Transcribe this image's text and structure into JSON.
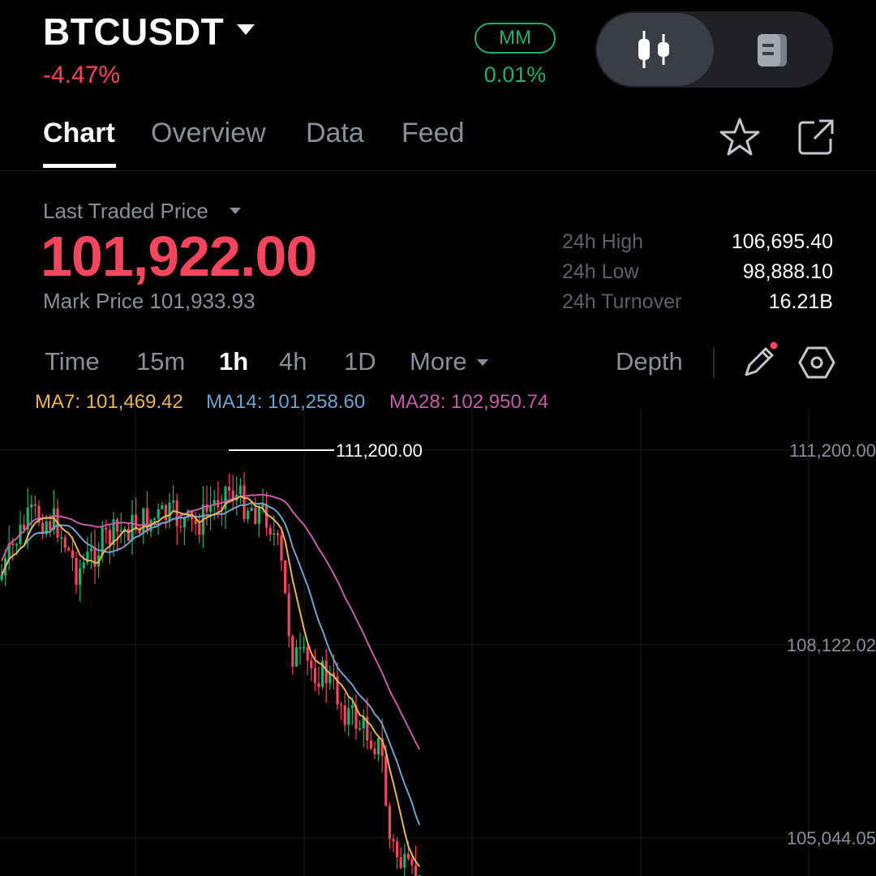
{
  "header": {
    "symbol": "BTCUSDT",
    "change_pct": "-4.47%",
    "mm_badge": "MM",
    "mm_value": "0.01%",
    "toggle_left_icon": "candlestick-icon",
    "toggle_right_icon": "document-icon"
  },
  "tabs": [
    {
      "label": "Chart",
      "active": true
    },
    {
      "label": "Overview",
      "active": false
    },
    {
      "label": "Data",
      "active": false
    },
    {
      "label": "Feed",
      "active": false
    }
  ],
  "tab_icons": [
    "star-icon",
    "share-icon"
  ],
  "price": {
    "last_traded_label": "Last Traded Price",
    "last_price": "101,922.00",
    "mark_price": "Mark Price 101,933.93"
  },
  "stats": [
    {
      "label": "24h High",
      "value": "106,695.40"
    },
    {
      "label": "24h Low",
      "value": "98,888.10"
    },
    {
      "label": "24h Turnover",
      "value": "16.21B"
    }
  ],
  "timeframes": [
    {
      "label": "Time",
      "active": false
    },
    {
      "label": "15m",
      "active": false
    },
    {
      "label": "1h",
      "active": true
    },
    {
      "label": "4h",
      "active": false
    },
    {
      "label": "1D",
      "active": false
    },
    {
      "label": "More",
      "active": false
    }
  ],
  "depth_label": "Depth",
  "tool_icons": [
    "pencil-icon",
    "hexagon-settings-icon"
  ],
  "moving_averages": [
    {
      "label": "MA7:",
      "value": "101,469.42",
      "color": "#e8b558"
    },
    {
      "label": "MA14:",
      "value": "101,258.60",
      "color": "#6fa3c9"
    },
    {
      "label": "MA28:",
      "value": "102,950.74",
      "color": "#c25fa8"
    }
  ],
  "chart_data": {
    "type": "candlestick",
    "y_ticks": [
      "111,200.00",
      "108,122.02",
      "105,044.05"
    ],
    "high_marker": "111,200.00",
    "colors": {
      "up": "#20b26c",
      "down": "#f6465d"
    },
    "grid": true
  }
}
